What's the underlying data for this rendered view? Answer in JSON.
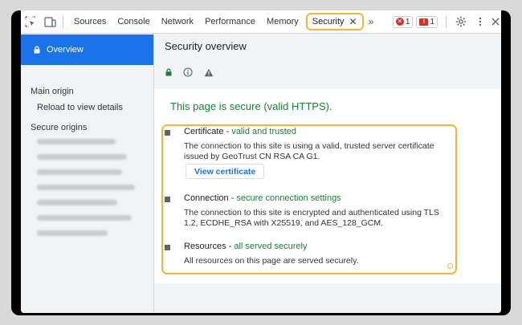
{
  "toolbar": {
    "tabs": [
      "Sources",
      "Console",
      "Network",
      "Performance",
      "Memory"
    ],
    "active_tab": "Security",
    "close_glyph": "✕",
    "more_tabs": "»",
    "error_count": "1",
    "warning_count": "1"
  },
  "sidebar": {
    "overview_label": "Overview",
    "main_origin_label": "Main origin",
    "reload_label": "Reload to view details",
    "secure_origins_label": "Secure origins"
  },
  "main": {
    "title": "Security overview",
    "secure_message": "This page is secure (valid HTTPS).",
    "certificate": {
      "title": "Certificate",
      "status": "valid and trusted",
      "description": "The connection to this site is using a valid, trusted server certificate issued by GeoTrust CN RSA CA G1.",
      "button": "View certificate"
    },
    "connection": {
      "title": "Connection",
      "status": "secure connection settings",
      "description": "The connection to this site is encrypted and authenticated using TLS 1.2, ECDHE_RSA with X25519, and AES_128_GCM."
    },
    "resources": {
      "title": "Resources",
      "status": "all served securely",
      "description": "All resources on this page are served securely."
    },
    "separator": " - "
  },
  "colors": {
    "accent": "#1a73e8",
    "secure_green": "#188038",
    "highlight": "#f5b829",
    "error_red": "#d93025"
  }
}
